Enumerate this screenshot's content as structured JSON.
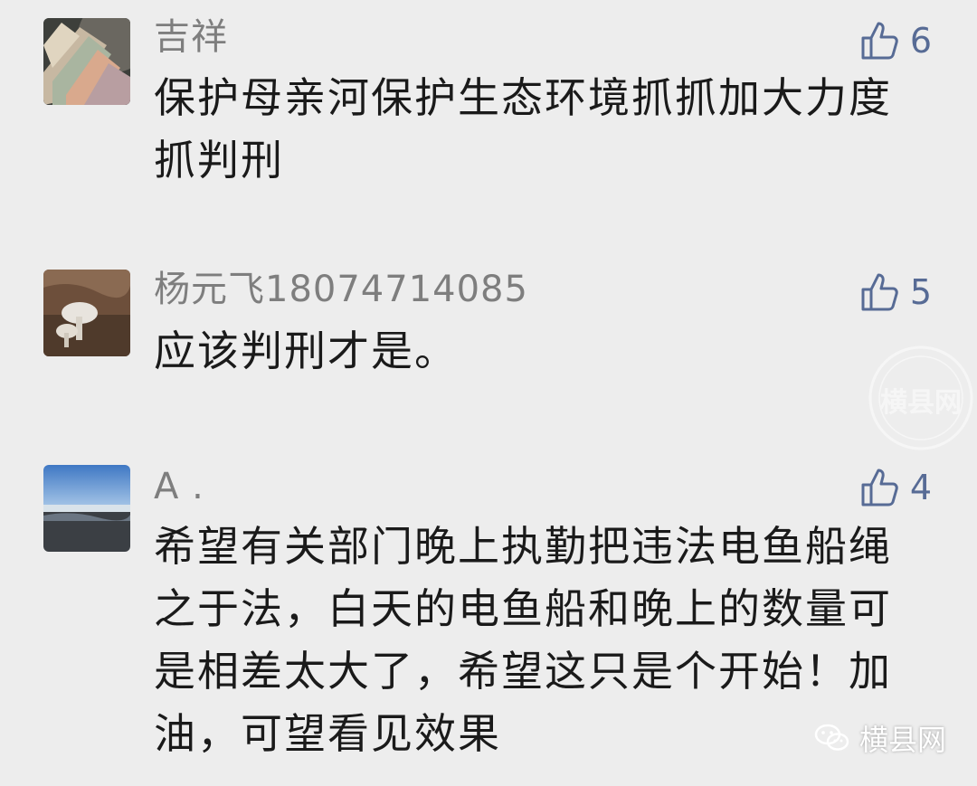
{
  "comments": [
    {
      "name": "吉祥",
      "text": "保护母亲河保护生态环境抓抓加大力度抓判刑",
      "likes": "6",
      "avatar_icon": "banknotes-avatar"
    },
    {
      "name": "杨元飞18074714085",
      "text": "应该判刑才是。",
      "likes": "5",
      "avatar_icon": "mushroom-avatar"
    },
    {
      "name": "A .",
      "text": "希望有关部门晚上执勤把违法电鱼船绳之于法，白天的电鱼船和晚上的数量可是相差太大了，希望这只是个开始！加油，可望看见效果",
      "likes": "4",
      "avatar_icon": "seascape-avatar"
    }
  ],
  "watermark": {
    "seal_text": "横县网",
    "brand_label": "横县网",
    "brand_icon": "wechat-icon"
  },
  "colors": {
    "background": "#ededed",
    "name": "#7e7e7e",
    "text": "#1a1a1a",
    "like": "#576b95"
  }
}
